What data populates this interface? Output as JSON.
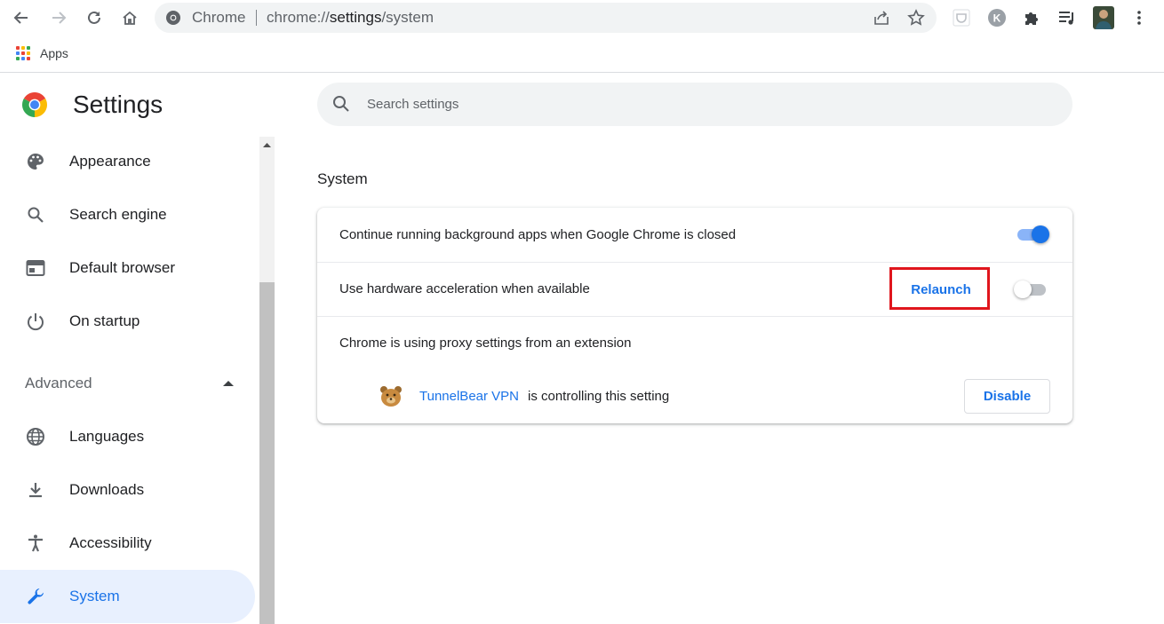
{
  "browser": {
    "omnibox": {
      "site_label": "Chrome",
      "url_prefix": "chrome://",
      "url_highlight": "settings",
      "url_suffix": "/system"
    },
    "bookmarks": {
      "apps_label": "Apps"
    }
  },
  "settings": {
    "title": "Settings",
    "search": {
      "placeholder": "Search settings"
    },
    "sidebar": {
      "items": [
        {
          "label": "Appearance",
          "icon": "palette-icon"
        },
        {
          "label": "Search engine",
          "icon": "search-icon"
        },
        {
          "label": "Default browser",
          "icon": "browser-window-icon"
        },
        {
          "label": "On startup",
          "icon": "power-icon"
        }
      ],
      "advanced_label": "Advanced",
      "advanced_items": [
        {
          "label": "Languages",
          "icon": "globe-icon"
        },
        {
          "label": "Downloads",
          "icon": "download-icon"
        },
        {
          "label": "Accessibility",
          "icon": "accessibility-icon"
        },
        {
          "label": "System",
          "icon": "wrench-icon",
          "active": true
        }
      ]
    },
    "main": {
      "section_title": "System",
      "rows": {
        "background_apps": {
          "label": "Continue running background apps when Google Chrome is closed",
          "enabled": true
        },
        "hardware_accel": {
          "label": "Use hardware acceleration when available",
          "enabled": false,
          "relaunch_label": "Relaunch"
        },
        "proxy": {
          "label": "Chrome is using proxy settings from an extension",
          "extension_name": "TunnelBear VPN",
          "controlling_text": "is controlling this setting",
          "disable_label": "Disable"
        }
      }
    }
  },
  "colors": {
    "accent": "#1a73e8",
    "highlight_box": "#e0161d",
    "active_nav_bg": "#e8f0fe"
  }
}
